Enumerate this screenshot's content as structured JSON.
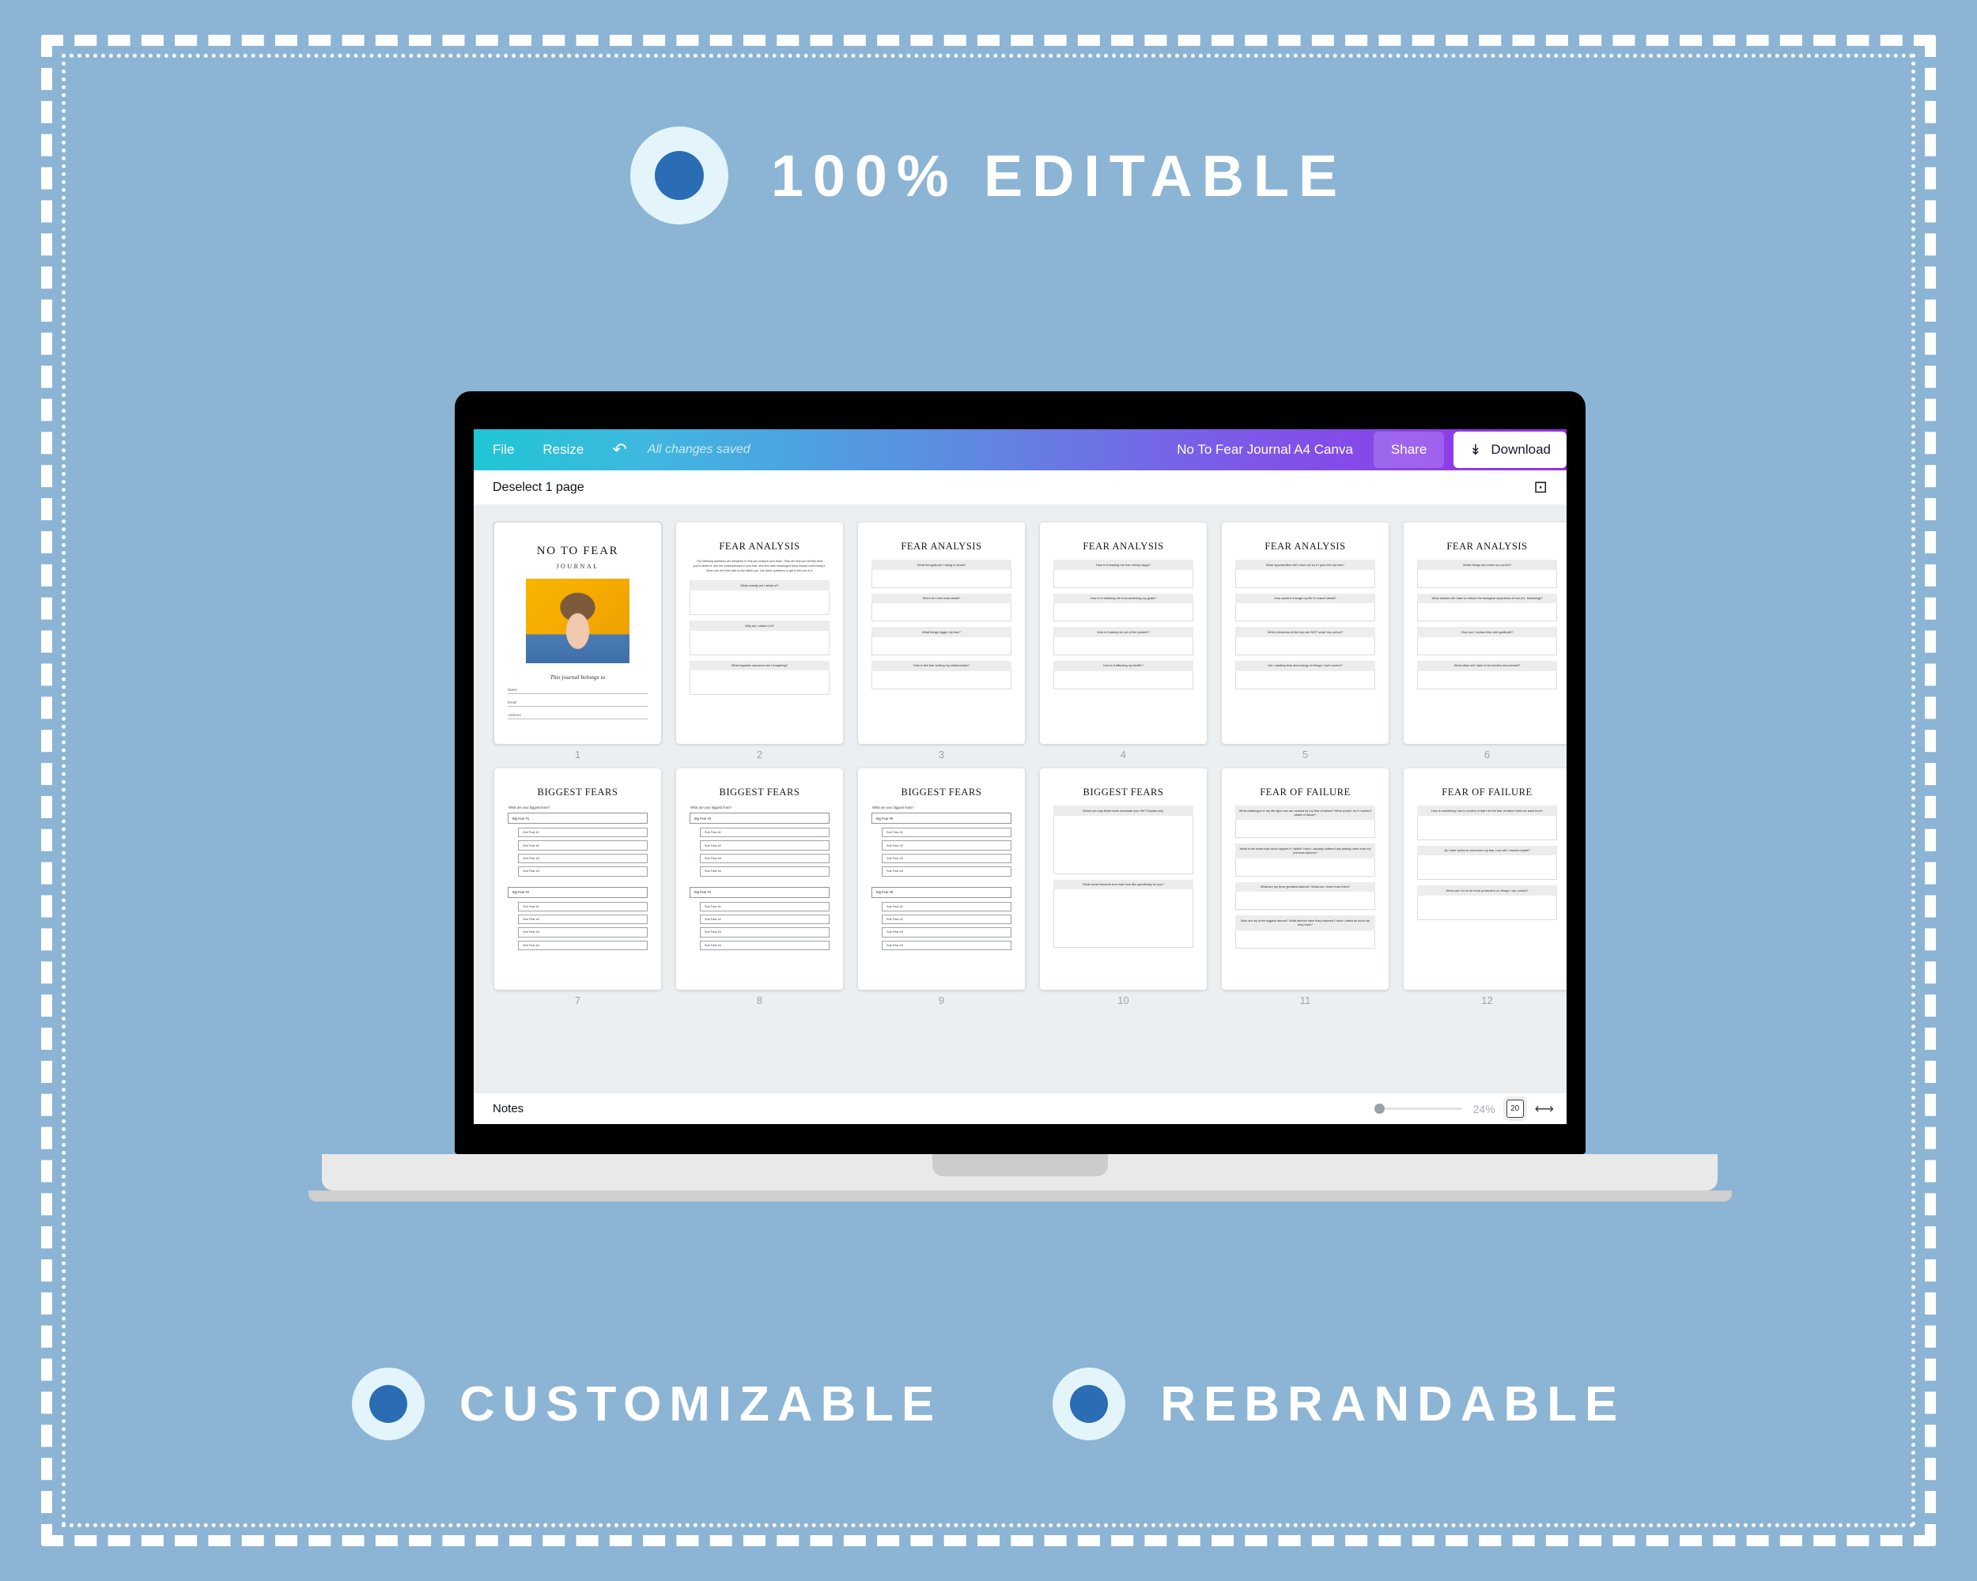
{
  "banners": {
    "top": {
      "label": "100% EDITABLE",
      "icon": "filled-circle-icon"
    },
    "bottom_left": {
      "label": "CUSTOMIZABLE",
      "icon": "filled-circle-icon"
    },
    "bottom_right": {
      "label": "REBRANDABLE",
      "icon": "filled-circle-icon"
    }
  },
  "colors": {
    "background": "#8cb4d4",
    "badge_outer": "#e3f4fb",
    "badge_inner": "#2a6db5",
    "toolbar_gradient_start": "#1fc6d4",
    "toolbar_gradient_end": "#9b2fe0",
    "thumbs_background": "#eceff1"
  },
  "toolbar": {
    "file_label": "File",
    "resize_label": "Resize",
    "undo_icon": "undo-arrow-icon",
    "saved_status": "All changes saved",
    "document_title": "No To Fear Journal A4 Canva",
    "share_label": "Share",
    "download_label": "Download",
    "download_icon": "download-icon"
  },
  "grid_header": {
    "deselect_label": "Deselect 1 page",
    "add_page_icon": "add-page-icon"
  },
  "status_bar": {
    "notes_label": "Notes",
    "zoom_percent": "24%",
    "page_count": "20",
    "expand_icon": "expand-arrows-icon"
  },
  "pages": [
    {
      "number": "1",
      "type": "cover",
      "title": "NO TO FEAR",
      "subtitle": "JOURNAL",
      "belongs_to": "This journal belongs to",
      "fields": [
        "Name",
        "Email",
        "Address"
      ]
    },
    {
      "number": "2",
      "type": "worksheet",
      "title": "FEAR ANALYSIS",
      "intro": "The following questions are designed to help you analyze your fears. They will help you identify what you're afraid of, see the consequences of your fear, and then take meaningful steps toward overcoming it. When you feel fear start to rise within you, use these questions to get to the root of it.",
      "questions": [
        "What exactly am I afraid of?",
        "Why am I afraid of it?",
        "What negative outcomes am I imagining?"
      ],
      "answer_size": "med"
    },
    {
      "number": "3",
      "type": "worksheet",
      "title": "FEAR ANALYSIS",
      "intro": "",
      "questions": [
        "What thoughts am I trying to avoid?",
        "When do I feel most afraid?",
        "What things trigger my fear?",
        "How is this fear hurting my relationships?"
      ],
      "answer_size": "short"
    },
    {
      "number": "4",
      "type": "worksheet",
      "title": "FEAR ANALYSIS",
      "intro": "",
      "questions": [
        "How is it keeping me from being happy?",
        "How is it hindering me from achieving my goals?",
        "How is it taking me out of the present?",
        "How is it affecting my health?"
      ],
      "answer_size": "short"
    },
    {
      "number": "5",
      "type": "worksheet",
      "title": "FEAR ANALYSIS",
      "intro": "",
      "questions": [
        "What opportunities will I miss out on if I give into my fear?",
        "How would it change my life if I wasn't afraid?",
        "Which elements of this fear are NOT under my control?",
        "Am I wasting time and energy on things I can't control?"
      ],
      "answer_size": "short"
    },
    {
      "number": "6",
      "type": "worksheet",
      "title": "FEAR ANALYSIS",
      "intro": "",
      "questions": [
        "Which things are under my control?",
        "What actions will I take to reduce the biological symptoms of fear (ex. breathing)?",
        "How can I replace fear with gratitude?",
        "What steps will I take to be mindful and present?"
      ],
      "answer_size": "short"
    },
    {
      "number": "7",
      "type": "fears-list",
      "title": "BIGGEST FEARS",
      "prompt": "What are your biggest fears?",
      "groups": [
        {
          "big": "Big Fear #1",
          "subs": [
            "Sub Fear #1",
            "Sub Fear #2",
            "Sub Fear #3",
            "Sub Fear #4"
          ]
        },
        {
          "big": "Big Fear #2",
          "subs": [
            "Sub Fear #1",
            "Sub Fear #2",
            "Sub Fear #3",
            "Sub Fear #4"
          ]
        }
      ]
    },
    {
      "number": "8",
      "type": "fears-list",
      "title": "BIGGEST FEARS",
      "prompt": "What are your biggest fears?",
      "groups": [
        {
          "big": "Big Fear #3",
          "subs": [
            "Sub Fear #1",
            "Sub Fear #2",
            "Sub Fear #3",
            "Sub Fear #4"
          ]
        },
        {
          "big": "Big Fear #4",
          "subs": [
            "Sub Fear #1",
            "Sub Fear #2",
            "Sub Fear #3",
            "Sub Fear #4"
          ]
        }
      ]
    },
    {
      "number": "9",
      "type": "fears-list",
      "title": "BIGGEST FEARS",
      "prompt": "What are your biggest fears?",
      "groups": [
        {
          "big": "Big Fear #5",
          "subs": [
            "Sub Fear #1",
            "Sub Fear #2",
            "Sub Fear #3",
            "Sub Fear #4"
          ]
        },
        {
          "big": "Big Fear #6",
          "subs": [
            "Sub Fear #1",
            "Sub Fear #2",
            "Sub Fear #3",
            "Sub Fear #4"
          ]
        }
      ]
    },
    {
      "number": "10",
      "type": "worksheet",
      "title": "BIGGEST FEARS",
      "intro": "",
      "questions": [
        "Would you say these fears dominate your life? Explain why.",
        "What would freedom from fear look like specifically for you?"
      ],
      "answer_size": "xtall"
    },
    {
      "number": "11",
      "type": "worksheet",
      "title": "FEAR OF FAILURE",
      "intro": "",
      "questions": [
        "What challenges in my life right now are caused by my fear of failure? What would I do if I weren't afraid of failure?",
        "What is the worst that could happen if I failed? Have I actually suffered any lasting harm from my previous failures?",
        "What are my three greatest failures? What can I learn from them?",
        "Who are my three biggest heroes? What failures have they endured? Have I failed as much as they have?"
      ],
      "answer_size": "short"
    },
    {
      "number": "12",
      "type": "worksheet",
      "title": "FEAR OF FAILURE",
      "intro": "",
      "questions": [
        "How is something I am in control of that I let the fear of failure hold me back from?",
        "As I take action to overcome my fear, how will I reward myself?",
        "What can I do to be more productive on things I can control?"
      ],
      "answer_size": "med"
    }
  ]
}
